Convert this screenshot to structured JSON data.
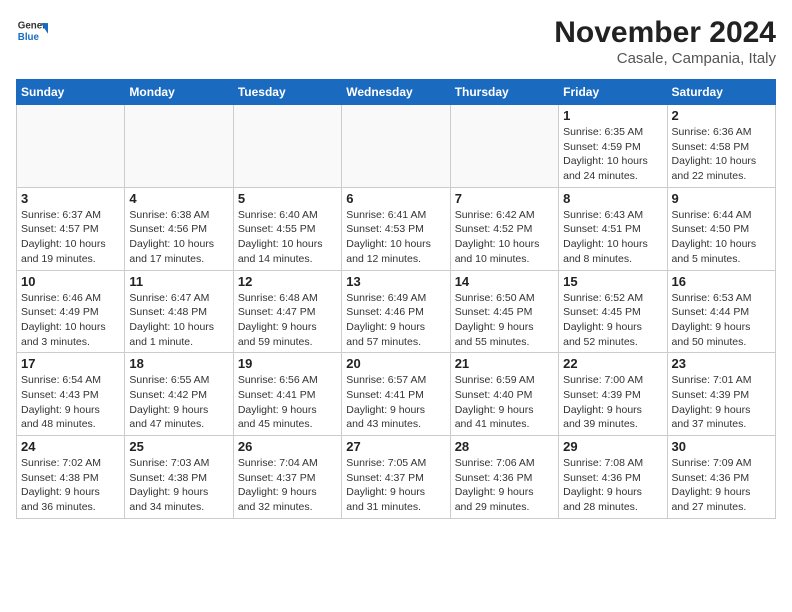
{
  "header": {
    "logo_line1": "General",
    "logo_line2": "Blue",
    "month_title": "November 2024",
    "location": "Casale, Campania, Italy"
  },
  "weekdays": [
    "Sunday",
    "Monday",
    "Tuesday",
    "Wednesday",
    "Thursday",
    "Friday",
    "Saturday"
  ],
  "weeks": [
    [
      {
        "day": "",
        "info": ""
      },
      {
        "day": "",
        "info": ""
      },
      {
        "day": "",
        "info": ""
      },
      {
        "day": "",
        "info": ""
      },
      {
        "day": "",
        "info": ""
      },
      {
        "day": "1",
        "info": "Sunrise: 6:35 AM\nSunset: 4:59 PM\nDaylight: 10 hours\nand 24 minutes."
      },
      {
        "day": "2",
        "info": "Sunrise: 6:36 AM\nSunset: 4:58 PM\nDaylight: 10 hours\nand 22 minutes."
      }
    ],
    [
      {
        "day": "3",
        "info": "Sunrise: 6:37 AM\nSunset: 4:57 PM\nDaylight: 10 hours\nand 19 minutes."
      },
      {
        "day": "4",
        "info": "Sunrise: 6:38 AM\nSunset: 4:56 PM\nDaylight: 10 hours\nand 17 minutes."
      },
      {
        "day": "5",
        "info": "Sunrise: 6:40 AM\nSunset: 4:55 PM\nDaylight: 10 hours\nand 14 minutes."
      },
      {
        "day": "6",
        "info": "Sunrise: 6:41 AM\nSunset: 4:53 PM\nDaylight: 10 hours\nand 12 minutes."
      },
      {
        "day": "7",
        "info": "Sunrise: 6:42 AM\nSunset: 4:52 PM\nDaylight: 10 hours\nand 10 minutes."
      },
      {
        "day": "8",
        "info": "Sunrise: 6:43 AM\nSunset: 4:51 PM\nDaylight: 10 hours\nand 8 minutes."
      },
      {
        "day": "9",
        "info": "Sunrise: 6:44 AM\nSunset: 4:50 PM\nDaylight: 10 hours\nand 5 minutes."
      }
    ],
    [
      {
        "day": "10",
        "info": "Sunrise: 6:46 AM\nSunset: 4:49 PM\nDaylight: 10 hours\nand 3 minutes."
      },
      {
        "day": "11",
        "info": "Sunrise: 6:47 AM\nSunset: 4:48 PM\nDaylight: 10 hours\nand 1 minute."
      },
      {
        "day": "12",
        "info": "Sunrise: 6:48 AM\nSunset: 4:47 PM\nDaylight: 9 hours\nand 59 minutes."
      },
      {
        "day": "13",
        "info": "Sunrise: 6:49 AM\nSunset: 4:46 PM\nDaylight: 9 hours\nand 57 minutes."
      },
      {
        "day": "14",
        "info": "Sunrise: 6:50 AM\nSunset: 4:45 PM\nDaylight: 9 hours\nand 55 minutes."
      },
      {
        "day": "15",
        "info": "Sunrise: 6:52 AM\nSunset: 4:45 PM\nDaylight: 9 hours\nand 52 minutes."
      },
      {
        "day": "16",
        "info": "Sunrise: 6:53 AM\nSunset: 4:44 PM\nDaylight: 9 hours\nand 50 minutes."
      }
    ],
    [
      {
        "day": "17",
        "info": "Sunrise: 6:54 AM\nSunset: 4:43 PM\nDaylight: 9 hours\nand 48 minutes."
      },
      {
        "day": "18",
        "info": "Sunrise: 6:55 AM\nSunset: 4:42 PM\nDaylight: 9 hours\nand 47 minutes."
      },
      {
        "day": "19",
        "info": "Sunrise: 6:56 AM\nSunset: 4:41 PM\nDaylight: 9 hours\nand 45 minutes."
      },
      {
        "day": "20",
        "info": "Sunrise: 6:57 AM\nSunset: 4:41 PM\nDaylight: 9 hours\nand 43 minutes."
      },
      {
        "day": "21",
        "info": "Sunrise: 6:59 AM\nSunset: 4:40 PM\nDaylight: 9 hours\nand 41 minutes."
      },
      {
        "day": "22",
        "info": "Sunrise: 7:00 AM\nSunset: 4:39 PM\nDaylight: 9 hours\nand 39 minutes."
      },
      {
        "day": "23",
        "info": "Sunrise: 7:01 AM\nSunset: 4:39 PM\nDaylight: 9 hours\nand 37 minutes."
      }
    ],
    [
      {
        "day": "24",
        "info": "Sunrise: 7:02 AM\nSunset: 4:38 PM\nDaylight: 9 hours\nand 36 minutes."
      },
      {
        "day": "25",
        "info": "Sunrise: 7:03 AM\nSunset: 4:38 PM\nDaylight: 9 hours\nand 34 minutes."
      },
      {
        "day": "26",
        "info": "Sunrise: 7:04 AM\nSunset: 4:37 PM\nDaylight: 9 hours\nand 32 minutes."
      },
      {
        "day": "27",
        "info": "Sunrise: 7:05 AM\nSunset: 4:37 PM\nDaylight: 9 hours\nand 31 minutes."
      },
      {
        "day": "28",
        "info": "Sunrise: 7:06 AM\nSunset: 4:36 PM\nDaylight: 9 hours\nand 29 minutes."
      },
      {
        "day": "29",
        "info": "Sunrise: 7:08 AM\nSunset: 4:36 PM\nDaylight: 9 hours\nand 28 minutes."
      },
      {
        "day": "30",
        "info": "Sunrise: 7:09 AM\nSunset: 4:36 PM\nDaylight: 9 hours\nand 27 minutes."
      }
    ]
  ]
}
